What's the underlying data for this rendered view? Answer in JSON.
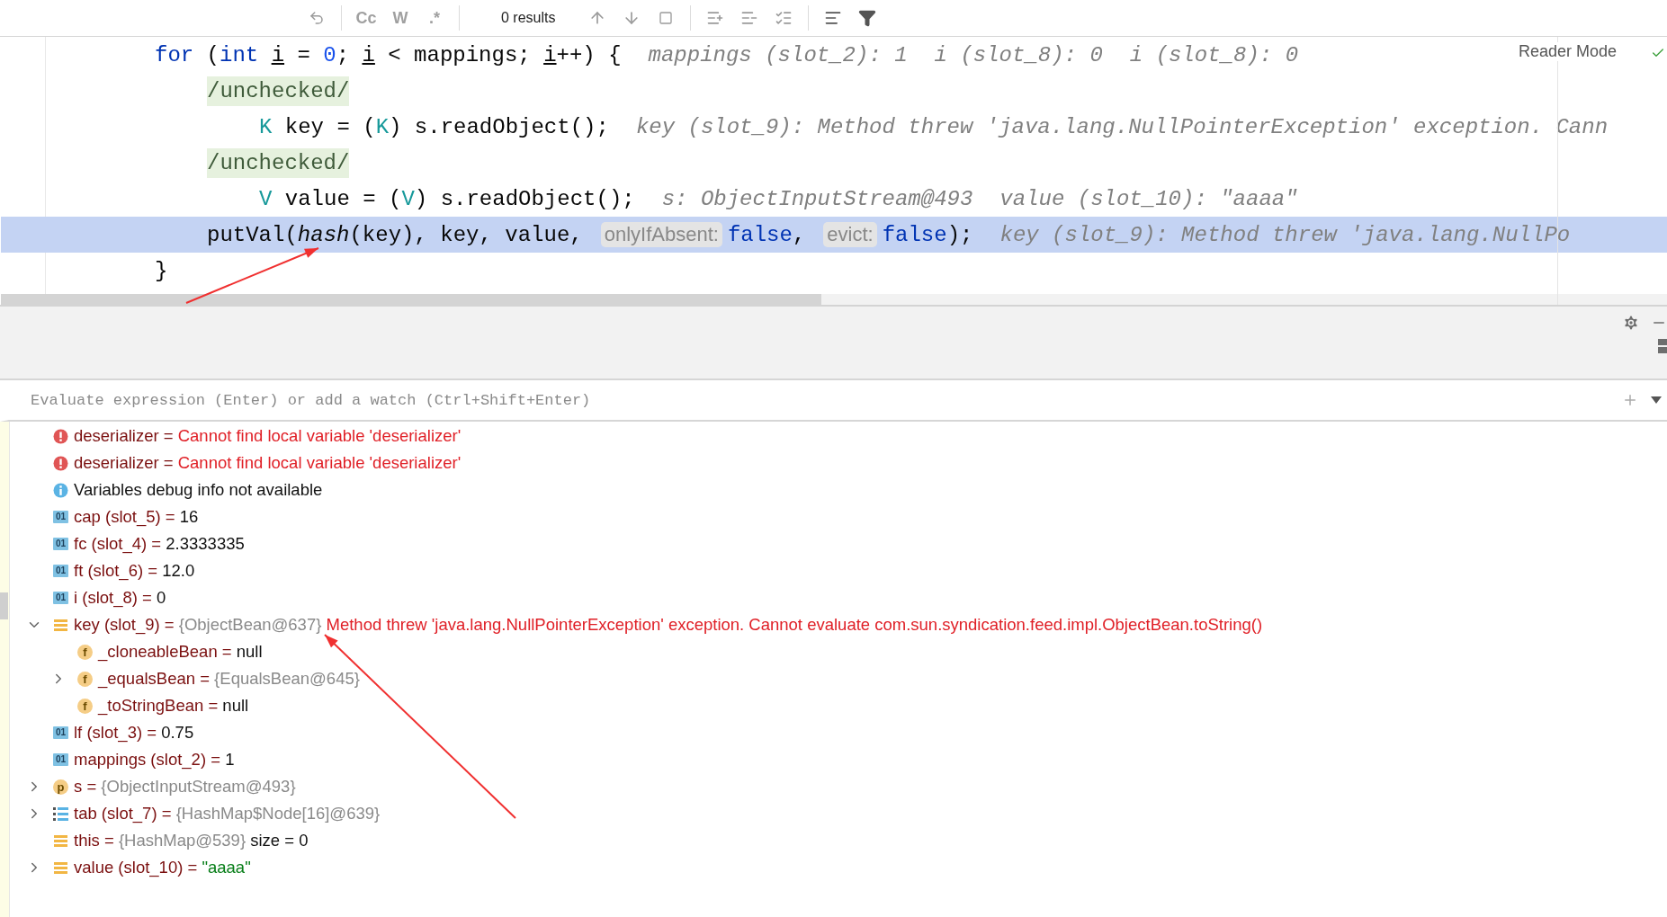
{
  "find_bar": {
    "options": [
      "Cc",
      "W",
      ".*"
    ],
    "results": "0 results"
  },
  "editor": {
    "reader_mode": "Reader Mode",
    "lines": [
      {
        "highlighted": false,
        "tokens": [
          {
            "kind": "kw",
            "text": "for"
          },
          {
            "kind": "plain",
            "text": " ("
          },
          {
            "kind": "kw",
            "text": "int "
          },
          {
            "kind": "var",
            "text": "i"
          },
          {
            "kind": "plain",
            "text": " = "
          },
          {
            "kind": "num",
            "text": "0"
          },
          {
            "kind": "plain",
            "text": "; "
          },
          {
            "kind": "var",
            "text": "i"
          },
          {
            "kind": "plain",
            "text": " < mappings; "
          },
          {
            "kind": "var",
            "text": "i"
          },
          {
            "kind": "plain",
            "text": "++) {"
          }
        ],
        "hints": [
          "mappings (slot_2): 1",
          "i (slot_8): 0",
          "i (slot_8): 0"
        ],
        "children": [
          {
            "highlighted": false,
            "tokens": [
              {
                "kind": "folded",
                "text": "/unchecked/"
              }
            ],
            "children": [
              {
                "highlighted": false,
                "tokens": [
                  {
                    "kind": "type",
                    "text": "K"
                  },
                  {
                    "kind": "plain",
                    "text": " key = ("
                  },
                  {
                    "kind": "type",
                    "text": "K"
                  },
                  {
                    "kind": "plain",
                    "text": ") s.readObject();"
                  }
                ],
                "hints": [
                  "key (slot_9): Method threw 'java.lang.NullPointerException' exception. Cann"
                ]
              }
            ]
          },
          {
            "highlighted": false,
            "tokens": [
              {
                "kind": "folded",
                "text": "/unchecked/"
              }
            ],
            "children": [
              {
                "highlighted": false,
                "tokens": [
                  {
                    "kind": "type",
                    "text": "V"
                  },
                  {
                    "kind": "plain",
                    "text": " value = ("
                  },
                  {
                    "kind": "type",
                    "text": "V"
                  },
                  {
                    "kind": "plain",
                    "text": ") s.readObject();"
                  }
                ],
                "hints": [
                  "s: ObjectInputStream@493",
                  "value (slot_10): \"aaaa\""
                ]
              }
            ]
          },
          {
            "highlighted": true,
            "tokens": [
              {
                "kind": "plain",
                "text": "putVal("
              },
              {
                "kind": "italic",
                "text": "hash"
              },
              {
                "kind": "plain",
                "text": "(key), key, value,"
              },
              {
                "kind": "param",
                "text": "onlyIfAbsent:"
              },
              {
                "kind": "kw",
                "text": "false"
              },
              {
                "kind": "plain",
                "text": ","
              },
              {
                "kind": "param",
                "text": "evict:"
              },
              {
                "kind": "kw",
                "text": "false"
              },
              {
                "kind": "plain",
                "text": ");"
              }
            ],
            "hints": [
              "key (slot_9): Method threw 'java.lang.NullPo"
            ]
          }
        ]
      },
      {
        "highlighted": false,
        "tokens": [
          {
            "kind": "plain",
            "text": "}"
          }
        ]
      }
    ]
  },
  "debugger": {
    "evaluate_placeholder": "Evaluate expression (Enter) or add a watch (Ctrl+Shift+Enter)",
    "variables": [
      {
        "kind": "error",
        "name": "deserializer =",
        "error": "Cannot find local variable 'deserializer'"
      },
      {
        "kind": "error",
        "name": "deserializer =",
        "error": "Cannot find local variable 'deserializer'"
      },
      {
        "kind": "info",
        "name": "Variables debug info not available"
      },
      {
        "kind": "primitive",
        "icon_label": "01",
        "name": "cap (slot_5) =",
        "value": "16"
      },
      {
        "kind": "primitive",
        "icon_label": "01",
        "name": "fc (slot_4) =",
        "value": "2.3333335"
      },
      {
        "kind": "primitive",
        "icon_label": "01",
        "name": "ft (slot_6) =",
        "value": "12.0"
      },
      {
        "kind": "primitive",
        "icon_label": "01",
        "name": "i (slot_8) =",
        "value": "0"
      },
      {
        "kind": "object",
        "name": "key (slot_9) =",
        "ref": "{ObjectBean@637}",
        "error": "Method threw 'java.lang.NullPointerException' exception. Cannot evaluate com.sun.syndication.feed.impl.ObjectBean.toString()",
        "expanded": true,
        "children": [
          {
            "kind": "field",
            "icon_label": "f",
            "name": "_cloneableBean =",
            "value": "null"
          },
          {
            "kind": "field",
            "icon_label": "f",
            "name": "_equalsBean =",
            "ref": "{EqualsBean@645}",
            "expanded": false
          },
          {
            "kind": "field",
            "icon_label": "f",
            "name": "_toStringBean =",
            "value": "null"
          }
        ]
      },
      {
        "kind": "primitive",
        "icon_label": "01",
        "name": "lf (slot_3) =",
        "value": "0.75"
      },
      {
        "kind": "primitive",
        "icon_label": "01",
        "name": "mappings (slot_2) =",
        "value": "1"
      },
      {
        "kind": "param",
        "icon_label": "p",
        "name": "s =",
        "ref": "{ObjectInputStream@493}",
        "expanded": false
      },
      {
        "kind": "array",
        "name": "tab (slot_7) =",
        "ref": "{HashMap$Node[16]@639}",
        "expanded": false
      },
      {
        "kind": "object",
        "name": "this =",
        "ref": "{HashMap@539}",
        "value": "size = 0"
      },
      {
        "kind": "object",
        "name": "value (slot_10) =",
        "string": "\"aaaa\"",
        "expanded": false
      }
    ]
  }
}
